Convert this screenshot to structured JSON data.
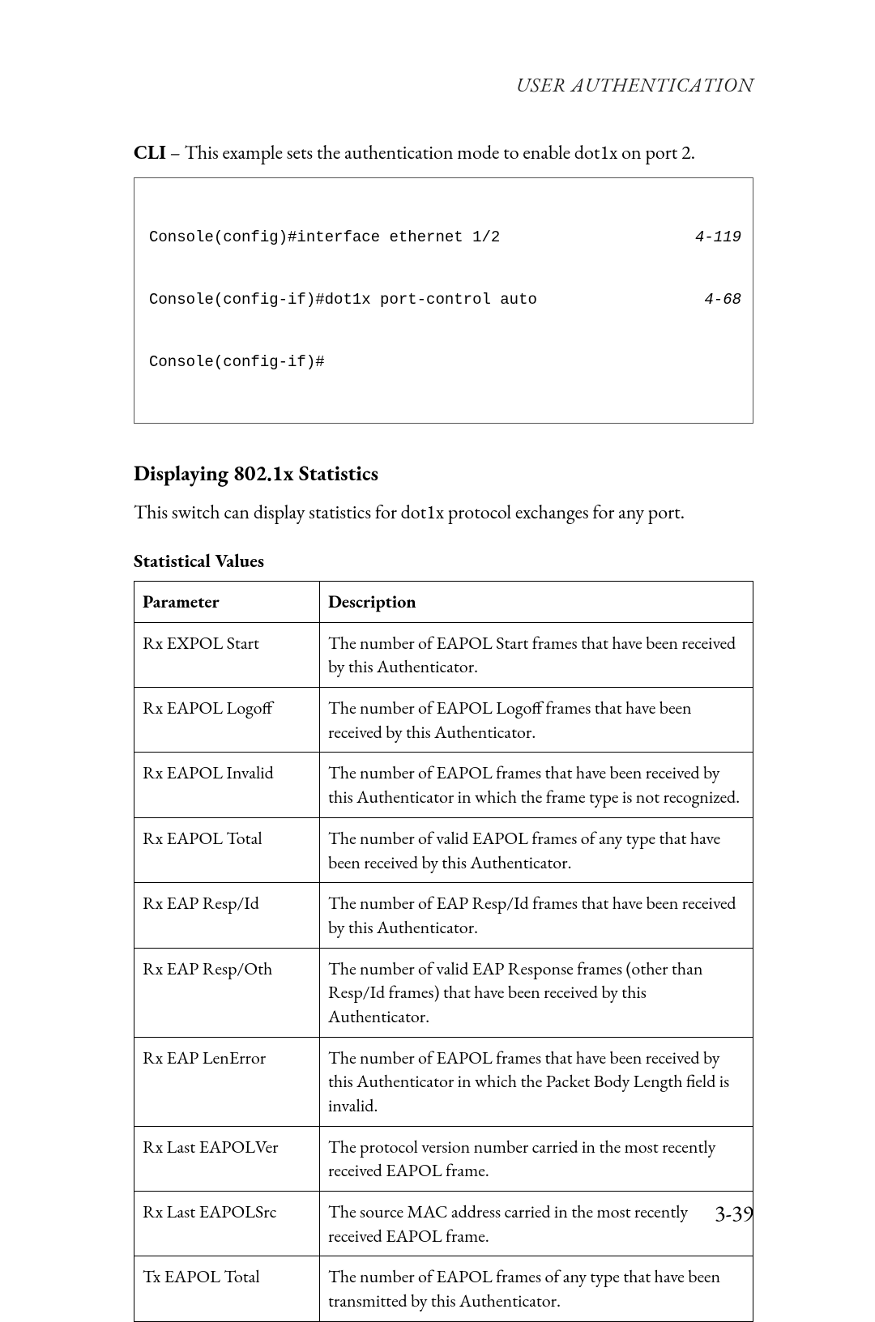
{
  "header": {
    "running_title": "User Authentication"
  },
  "intro": {
    "cli_label": "CLI",
    "cli_text": " – This example sets the authentication mode to enable dot1x on port 2."
  },
  "code": {
    "lines": [
      {
        "cmd": "Console(config)#interface ethernet 1/2",
        "ref": "4-119"
      },
      {
        "cmd": "Console(config-if)#dot1x port-control auto",
        "ref": "4-68"
      },
      {
        "cmd": "Console(config-if)#",
        "ref": ""
      }
    ]
  },
  "section": {
    "title": "Displaying 802.1x Statistics",
    "text": "This switch can display statistics for dot1x protocol exchanges for any port.",
    "subhead": "Statistical Values"
  },
  "table": {
    "headers": {
      "param": "Parameter",
      "desc": "Description"
    },
    "rows": [
      {
        "param": "Rx EXPOL Start",
        "desc": "The number of EAPOL Start frames that have been received by this Authenticator."
      },
      {
        "param": "Rx EAPOL Logoff",
        "desc": "The number of EAPOL Logoff frames that have been received by this Authenticator."
      },
      {
        "param": "Rx EAPOL Invalid",
        "desc": "The number of EAPOL frames that have been received by this Authenticator in which the frame type is not recognized."
      },
      {
        "param": "Rx EAPOL Total",
        "desc": "The number of valid EAPOL frames of any type that have been received by this Authenticator."
      },
      {
        "param": "Rx EAP Resp/Id",
        "desc": "The number of EAP Resp/Id frames that have been received by this Authenticator."
      },
      {
        "param": "Rx EAP Resp/Oth",
        "desc": "The number of valid EAP Response frames (other than Resp/Id frames) that have been received by this Authenticator."
      },
      {
        "param": "Rx EAP LenError",
        "desc": "The number of EAPOL frames that have been received by this Authenticator in which the Packet Body Length field is invalid."
      },
      {
        "param": "Rx Last EAPOLVer",
        "desc": "The protocol version number carried in the most recently received EAPOL frame."
      },
      {
        "param": "Rx Last EAPOLSrc",
        "desc": "The source MAC address carried in the most recently received EAPOL frame."
      },
      {
        "param": "Tx EAPOL Total",
        "desc": "The number of EAPOL frames of any type that have been transmitted by this Authenticator."
      }
    ]
  },
  "footer": {
    "page_number": "3-39"
  }
}
